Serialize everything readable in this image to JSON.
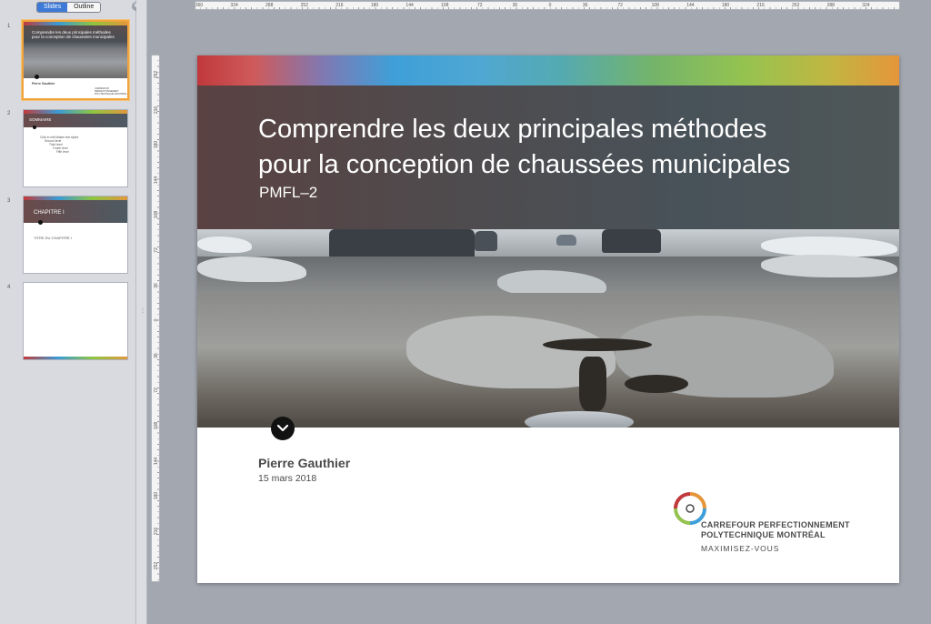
{
  "left_pane": {
    "tabs": [
      "Slides",
      "Outline"
    ],
    "close_glyph": "⊗",
    "thumbnails": [
      {
        "number": "1",
        "title": "Comprendre les deux principales méthodes pour la conception de chaussées municipales",
        "subtitle": "PMFL-2",
        "author": "Pierre Gauthier",
        "logo_line1": "CARREFOUR PERFECTIONNEMENT",
        "logo_line2": "POLYTECHNIQUE MONTRÉAL"
      },
      {
        "number": "2",
        "band_label": "SOMMAIRE",
        "line1": "Click to edit Master text styles",
        "line2": "Second level",
        "line3": "Third level",
        "line4": "Fourth level",
        "line5": "Fifth level"
      },
      {
        "number": "3",
        "band_label": "CHAPITRE I",
        "sub": "TITRE DU CHAPITRE I"
      },
      {
        "number": "4"
      }
    ]
  },
  "ruler": {
    "horizontal_labels": [
      "360",
      "324",
      "288",
      "252",
      "216",
      "180",
      "144",
      "108",
      "72",
      "36",
      "0",
      "36",
      "72",
      "108",
      "144",
      "180",
      "216",
      "252",
      "288",
      "324"
    ],
    "vertical_labels": [
      "252",
      "216",
      "180",
      "144",
      "108",
      "72",
      "36",
      "0",
      "36",
      "72",
      "108",
      "144",
      "180",
      "216",
      "252"
    ]
  },
  "slide": {
    "title_line1": "Comprendre les deux principales méthodes",
    "title_line2": "pour la conception de chaussées municipales",
    "subtitle": "PMFL–2",
    "author": "Pierre Gauthier",
    "date": "15 mars 2018",
    "org_line1": "CARREFOUR PERFECTIONNEMENT",
    "org_line2": "POLYTECHNIQUE MONTRÉAL",
    "org_tagline": "MAXIMISEZ-VOUS",
    "colors": {
      "bar": [
        "#c0393c",
        "#3f9fd8",
        "#95c350",
        "#e5963a"
      ],
      "title_panel": "#4f4b4d"
    },
    "icons": {
      "scroll": "chevron-down-icon",
      "logo": "crosshair-logo-icon"
    }
  }
}
